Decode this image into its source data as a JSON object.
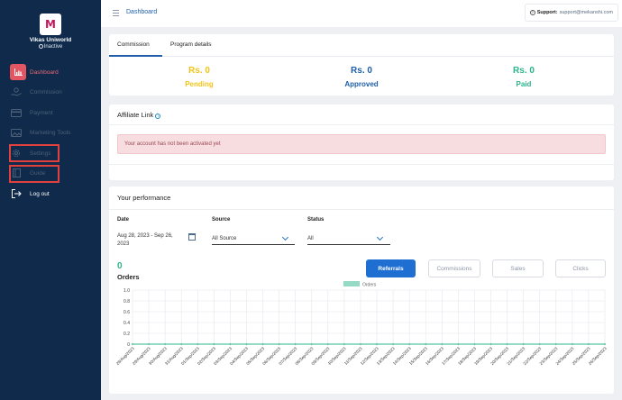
{
  "sidebar": {
    "org_name": "Vikas Uniworld",
    "org_status": "Inactive",
    "items": [
      {
        "label": "Dashboard",
        "icon": "chart-bar-icon"
      },
      {
        "label": "Commission",
        "icon": "hand-coin-icon"
      },
      {
        "label": "Payment",
        "icon": "credit-card-icon"
      },
      {
        "label": "Marketing Tools",
        "icon": "image-icon"
      },
      {
        "label": "Settings",
        "icon": "gear-icon"
      },
      {
        "label": "Guide",
        "icon": "book-icon"
      },
      {
        "label": "Log out",
        "icon": "logout-icon"
      }
    ]
  },
  "header": {
    "breadcrumb": "Dashboard",
    "support_label": "Support:",
    "support_email": "support@mekanshi.com"
  },
  "tabs": [
    "Commission",
    "Program details"
  ],
  "stats": [
    {
      "value": "Rs. 0",
      "label": "Pending",
      "color": "#f0c419"
    },
    {
      "value": "Rs. 0",
      "label": "Approved",
      "color": "#1f5ea8"
    },
    {
      "value": "Rs. 0",
      "label": "Paid",
      "color": "#2bb58b"
    }
  ],
  "affiliate": {
    "title": "Affiliate Link",
    "alert": "Your account has not been activated yet"
  },
  "performance": {
    "title": "Your performance",
    "date_label": "Date",
    "date_value_line1": "Aug 28, 2023 - Sep 26,",
    "date_value_line2": "2023",
    "source_label": "Source",
    "source_value": "All Source",
    "status_label": "Status",
    "status_value": "All",
    "orders_count": "0",
    "orders_label": "Orders",
    "buttons": [
      "Referrals",
      "Commissions",
      "Sales",
      "Clicks"
    ]
  },
  "chart_data": {
    "type": "line",
    "series": [
      {
        "name": "Orders",
        "color": "#2bb58b",
        "values": [
          0,
          0,
          0,
          0,
          0,
          0,
          0,
          0,
          0,
          0,
          0,
          0,
          0,
          0,
          0,
          0,
          0,
          0,
          0,
          0,
          0,
          0,
          0,
          0,
          0,
          0,
          0,
          0,
          0,
          0
        ]
      }
    ],
    "x": [
      "28/Aug/2023",
      "29/Aug/2023",
      "30/Aug/2023",
      "31/Aug/2023",
      "01/Sep/2023",
      "02/Sep/2023",
      "03/Sep/2023",
      "04/Sep/2023",
      "05/Sep/2023",
      "06/Sep/2023",
      "07/Sep/2023",
      "08/Sep/2023",
      "09/Sep/2023",
      "10/Sep/2023",
      "11/Sep/2023",
      "12/Sep/2023",
      "13/Sep/2023",
      "14/Sep/2023",
      "15/Sep/2023",
      "16/Sep/2023",
      "17/Sep/2023",
      "18/Sep/2023",
      "19/Sep/2023",
      "20/Sep/2023",
      "21/Sep/2023",
      "22/Sep/2023",
      "23/Sep/2023",
      "24/Sep/2023",
      "25/Sep/2023",
      "26/Sep/2023"
    ],
    "y_ticks": [
      "1.0",
      "0.8",
      "0.6",
      "0.4",
      "0.2",
      "0"
    ],
    "ylim": [
      0,
      1
    ],
    "grid": true,
    "legend_position": "top-center"
  }
}
